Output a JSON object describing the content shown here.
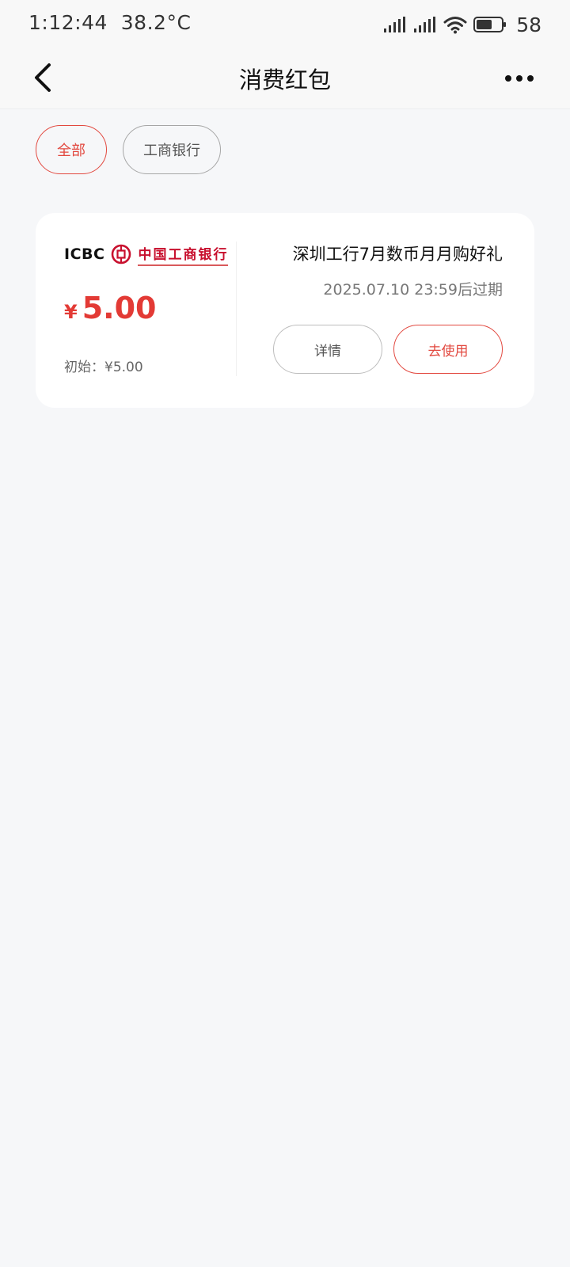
{
  "status_bar": {
    "time": "1:12:44",
    "temperature": "38.2°C",
    "battery_level": "58",
    "icons": [
      "signal-icon",
      "signal-icon",
      "wifi-icon",
      "battery-icon"
    ]
  },
  "nav": {
    "title": "消费红包",
    "back_icon": "chevron-left-icon",
    "more_icon": "more-horizontal-icon"
  },
  "filters": [
    {
      "label": "全部",
      "active": true
    },
    {
      "label": "工商银行",
      "active": false
    }
  ],
  "coupon": {
    "bank_logo_en": "ICBC",
    "bank_logo_cn": "中国工商银行",
    "currency_symbol": "¥",
    "amount": "5.00",
    "initial_amount": "初始：¥5.00",
    "title": "深圳工行7月数币月月购好礼",
    "expiry": "2025.07.10 23:59后过期",
    "detail_button": "详情",
    "use_button": "去使用"
  },
  "colors": {
    "accent": "#e2483f",
    "amount": "#e33a35",
    "background": "#f6f7f9",
    "card": "#ffffff"
  }
}
